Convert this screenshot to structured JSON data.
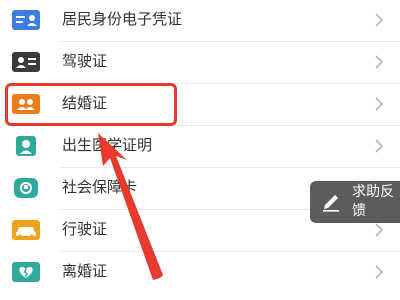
{
  "items": [
    {
      "label": "居民身份电子凭证",
      "icon": "id-card-icon",
      "color": "#3a7fe0"
    },
    {
      "label": "驾驶证",
      "icon": "driver-license-icon",
      "color": "#3b3b3b"
    },
    {
      "label": "结婚证",
      "icon": "marriage-certificate-icon",
      "color": "#ef7a1a"
    },
    {
      "label": "出生医学证明",
      "icon": "birth-certificate-icon",
      "color": "#2fa99a"
    },
    {
      "label": "社会保障卡",
      "icon": "social-security-card-icon",
      "color": "#2fa99a"
    },
    {
      "label": "行驶证",
      "icon": "vehicle-license-icon",
      "color": "#f0a31a"
    },
    {
      "label": "离婚证",
      "icon": "divorce-certificate-icon",
      "color": "#2fa99a"
    }
  ],
  "help_button": {
    "label": "求助反馈",
    "icon": "pen-icon"
  },
  "annotation": {
    "highlight_color": "#e8392f"
  }
}
